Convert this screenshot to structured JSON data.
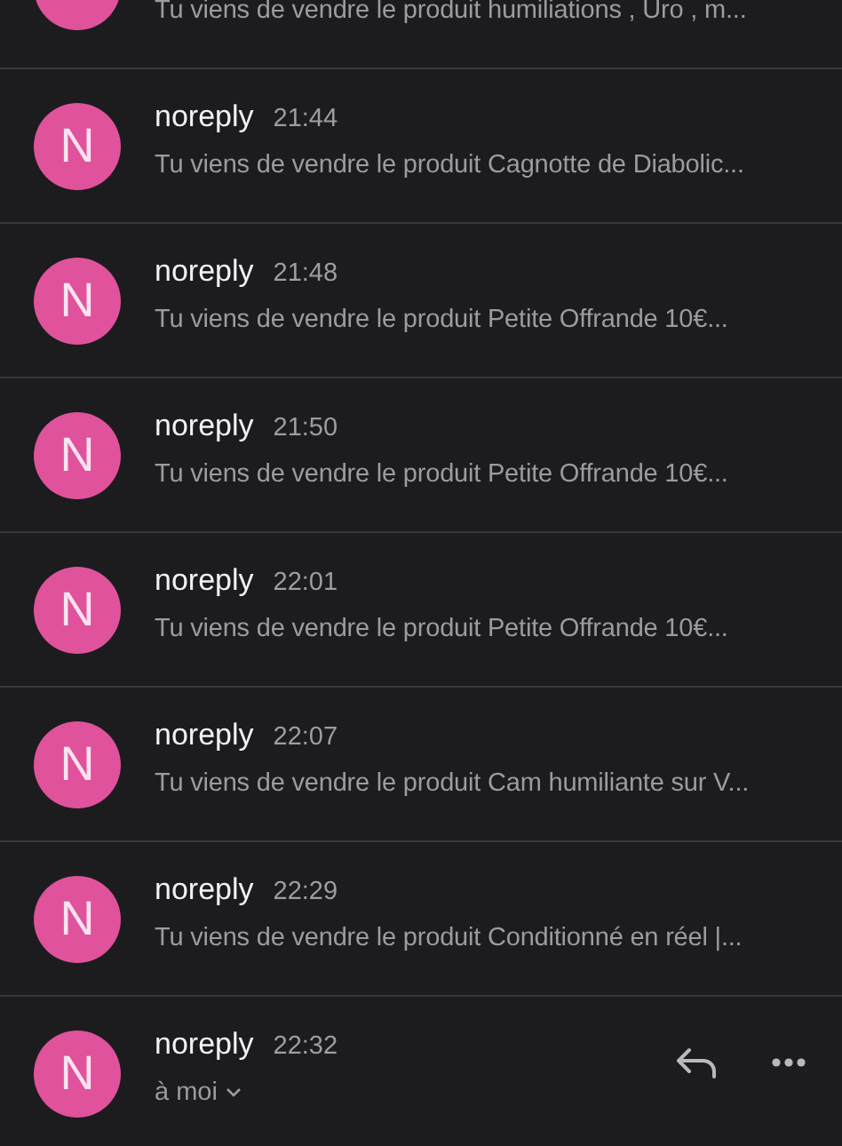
{
  "messages": [
    {
      "kind": "cut",
      "preview": "Tu viens de vendre le produit humiliations , Uro , m..."
    },
    {
      "kind": "full",
      "avatar": "N",
      "sender": "noreply",
      "time": "21:44",
      "preview": "Tu viens de vendre le produit Cagnotte de Diabolic..."
    },
    {
      "kind": "full",
      "avatar": "N",
      "sender": "noreply",
      "time": "21:48",
      "preview": "Tu viens de vendre le produit Petite Offrande 10€..."
    },
    {
      "kind": "full",
      "avatar": "N",
      "sender": "noreply",
      "time": "21:50",
      "preview": "Tu viens de vendre le produit Petite Offrande 10€..."
    },
    {
      "kind": "full",
      "avatar": "N",
      "sender": "noreply",
      "time": "22:01",
      "preview": "Tu viens de vendre le produit Petite Offrande 10€..."
    },
    {
      "kind": "full",
      "avatar": "N",
      "sender": "noreply",
      "time": "22:07",
      "preview": "Tu viens de vendre le produit Cam humiliante sur V..."
    },
    {
      "kind": "full",
      "avatar": "N",
      "sender": "noreply",
      "time": "22:29",
      "preview": "Tu viens de vendre le produit Conditionné en réel |..."
    },
    {
      "kind": "open",
      "avatar": "N",
      "sender": "noreply",
      "time": "22:32",
      "recipient": "à moi"
    }
  ]
}
